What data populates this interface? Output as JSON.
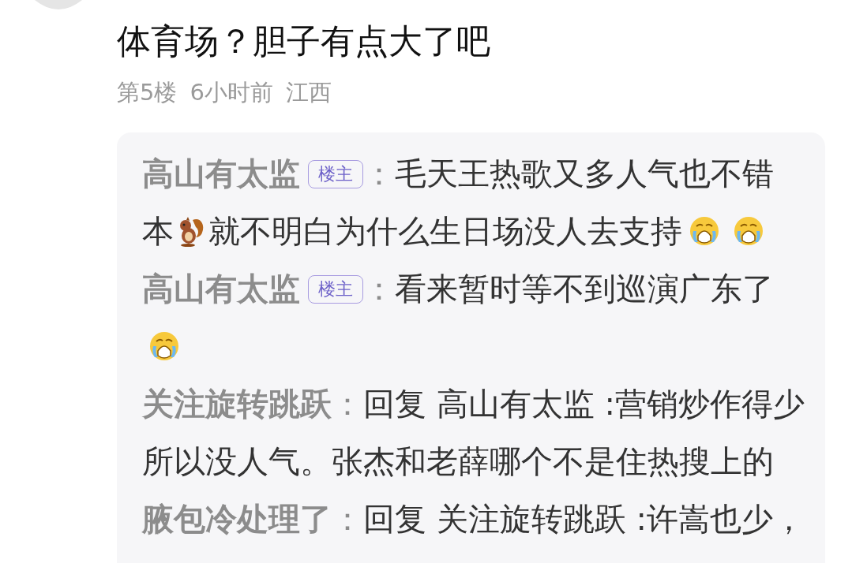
{
  "comment": {
    "text": "体育场？胆子有点大了吧",
    "floor": "第5楼",
    "time": "6小时前",
    "location": "江西"
  },
  "replies": [
    {
      "author": "高山有太监",
      "badge": "楼主",
      "separator": "：",
      "lines": [
        [
          {
            "kind": "text",
            "text": "毛天王热歌又多人气也不错"
          }
        ],
        [
          {
            "kind": "text",
            "text": "本"
          },
          {
            "kind": "squirrel"
          },
          {
            "kind": "text",
            "text": "就不明白为什么生日场没人去支持"
          },
          {
            "kind": "crying"
          },
          {
            "kind": "crying"
          }
        ]
      ]
    },
    {
      "author": "高山有太监",
      "badge": "楼主",
      "separator": "：",
      "lines": [
        [
          {
            "kind": "text",
            "text": "看来暂时等不到巡演广东了"
          }
        ],
        [
          {
            "kind": "crying"
          }
        ]
      ]
    },
    {
      "author": "关注旋转跳跃",
      "separator": "：",
      "lines": [
        [
          {
            "kind": "text",
            "text": "回复 高山有太监 :营销炒作得少"
          }
        ],
        [
          {
            "kind": "text",
            "text": "所以没人气。张杰和老薛哪个不是住热搜上的"
          }
        ]
      ]
    },
    {
      "author": "腋包冷处理了",
      "separator": "：",
      "lines": [
        [
          {
            "kind": "text",
            "text": "回复 关注旋转跳跃 :许嵩也少，"
          }
        ]
      ]
    }
  ]
}
